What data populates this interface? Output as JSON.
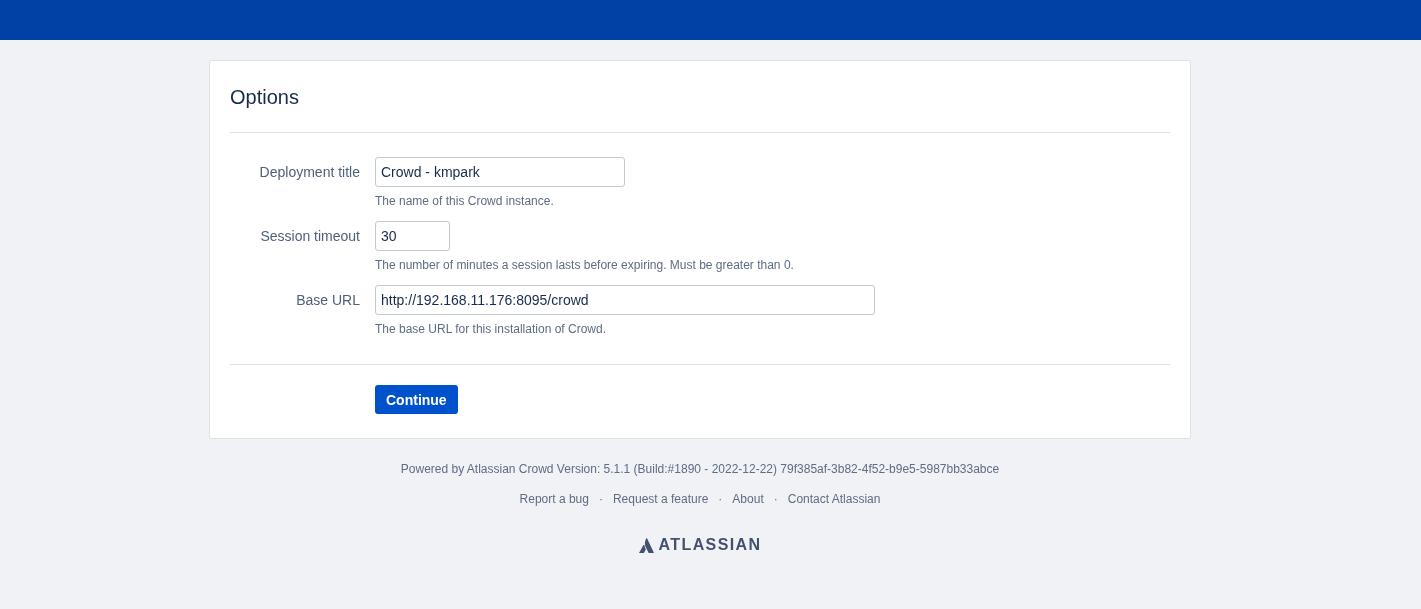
{
  "panel": {
    "title": "Options",
    "fields": [
      {
        "kind": "text",
        "label": "Deployment title",
        "value": "Crowd - kmpark",
        "help": "The name of this Crowd instance."
      },
      {
        "kind": "number",
        "label": "Session timeout",
        "value": "30",
        "help": "The number of minutes a session lasts before expiring. Must be greater than 0."
      },
      {
        "kind": "url",
        "label": "Base URL",
        "value": "http://192.168.11.176:8095/crowd",
        "help": "The base URL for this installation of Crowd."
      }
    ],
    "buttons": [
      {
        "label": "Continue"
      }
    ]
  },
  "footer": {
    "version_text": "Powered by Atlassian Crowd Version: 5.1.1 (Build:#1890 - 2022-12-22) 79f385af-3b82-4f52-b9e5-5987bb33abce",
    "links": [
      {
        "label": "Report a bug"
      },
      {
        "label": "Request a feature"
      },
      {
        "label": "About"
      },
      {
        "label": "Contact Atlassian"
      }
    ],
    "separators": [
      "·",
      "·",
      "·"
    ],
    "logo": {
      "wordmark": "ATLASSIAN"
    }
  }
}
